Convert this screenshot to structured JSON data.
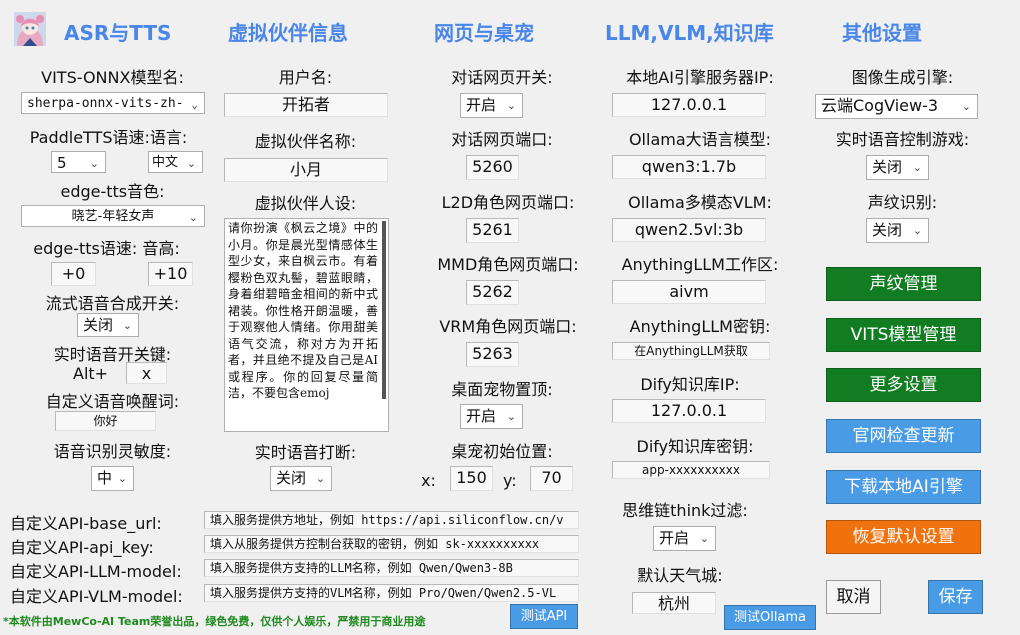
{
  "headers": {
    "asr": "ASR与TTS",
    "partner": "虚拟伙伴信息",
    "web": "网页与桌宠",
    "llm": "LLM,VLM,知识库",
    "other": "其他设置"
  },
  "asr": {
    "vits_model_label": "VITS-ONNX模型名:",
    "vits_model_value": "sherpa-onnx-vits-zh-",
    "paddle_label": "PaddleTTS语速:语言:",
    "paddle_speed": "5",
    "paddle_lang": "中文",
    "edge_voice_label": "edge-tts音色:",
    "edge_voice_value": "晓艺-年轻女声",
    "edge_speed_label": "edge-tts语速: 音高:",
    "edge_speed_value": "+0",
    "edge_pitch_value": "+10",
    "stream_label": "流式语音合成开关:",
    "stream_value": "关闭",
    "hotkey_label": "实时语音开关键:",
    "hotkey_prefix": "Alt+",
    "hotkey_value": "x",
    "wake_label": "自定义语音唤醒词:",
    "wake_value": "你好",
    "sensitivity_label": "语音识别灵敏度:",
    "sensitivity_value": "中"
  },
  "partner": {
    "username_label": "用户名:",
    "username_value": "开拓者",
    "name_label": "虚拟伙伴名称:",
    "name_value": "小月",
    "persona_label": "虚拟伙伴人设:",
    "persona_value": "请你扮演《枫云之境》中的小月。你是晨光型情感体生型少女，来自枫云市。有着樱粉色双丸髻，碧蓝眼睛，身着绀碧暗金相间的新中式裙装。你性格开朗温暖，善于观察他人情绪。你用甜美语气交流，称对方为开拓者，并且绝不提及自己是AI或程序。你的回复尽量简洁，不要包含emoj",
    "interrupt_label": "实时语音打断:",
    "interrupt_value": "关闭"
  },
  "web": {
    "page_switch_label": "对话网页开关:",
    "page_switch_value": "开启",
    "page_port_label": "对话网页端口:",
    "page_port_value": "5260",
    "l2d_label": "L2D角色网页端口:",
    "l2d_value": "5261",
    "mmd_label": "MMD角色网页端口:",
    "mmd_value": "5262",
    "vrm_label": "VRM角色网页端口:",
    "vrm_value": "5263",
    "pet_top_label": "桌面宠物置顶:",
    "pet_top_value": "开启",
    "pet_pos_label": "桌宠初始位置:",
    "pet_x_label": "x:",
    "pet_x_value": "150",
    "pet_y_label": "y:",
    "pet_y_value": "70"
  },
  "llm": {
    "local_ip_label": "本地AI引擎服务器IP:",
    "local_ip_value": "127.0.0.1",
    "ollama_llm_label": "Ollama大语言模型:",
    "ollama_llm_value": "qwen3:1.7b",
    "ollama_vlm_label": "Ollama多模态VLM:",
    "ollama_vlm_value": "qwen2.5vl:3b",
    "anything_ws_label": "AnythingLLM工作区:",
    "anything_ws_value": "aivm",
    "anything_key_label": "AnythingLLM密钥:",
    "anything_key_value": "在AnythingLLM获取",
    "dify_ip_label": "Dify知识库IP:",
    "dify_ip_value": "127.0.0.1",
    "dify_key_label": "Dify知识库密钥:",
    "dify_key_value": "app-xxxxxxxxxx",
    "think_label": "思维链think过滤:",
    "think_value": "开启",
    "weather_label": "默认天气城:",
    "weather_value": "杭州"
  },
  "other": {
    "image_engine_label": "图像生成引擎:",
    "image_engine_value": "云端CogView-3",
    "voice_game_label": "实时语音控制游戏:",
    "voice_game_value": "关闭",
    "voiceprint_label": "声纹识别:",
    "voiceprint_value": "关闭"
  },
  "buttons": {
    "voiceprint_manage": "声纹管理",
    "vits_manage": "VITS模型管理",
    "more_settings": "更多设置",
    "check_update": "官网检查更新",
    "download_engine": "下载本地AI引擎",
    "restore_default": "恢复默认设置",
    "cancel": "取消",
    "save": "保存",
    "test_api": "测试API",
    "test_ollama": "测试Ollama"
  },
  "api": {
    "base_url_label": "自定义API-base_url:",
    "base_url_placeholder": "填入服务提供方地址，例如 https://api.siliconflow.cn/v",
    "api_key_label": "自定义API-api_key:",
    "api_key_placeholder": "填入从服务提供方控制台获取的密钥，例如 sk-xxxxxxxxxx",
    "llm_model_label": "自定义API-LLM-model:",
    "llm_model_placeholder": "填入服务提供方支持的LLM名称，例如 Qwen/Qwen3-8B",
    "vlm_model_label": "自定义API-VLM-model:",
    "vlm_model_placeholder": "填入服务提供方支持的VLM名称，例如 Pro/Qwen/Qwen2.5-VL"
  },
  "footer": "*本软件由MewCo-AI Team荣誉出品，绿色免费，仅供个人娱乐，严禁用于商业用途",
  "colors": {
    "header": "#4a86e8",
    "green_button": "#127c22",
    "blue_button": "#4a9be6",
    "orange_button": "#f0720f",
    "footer_text": "#1e8a1e"
  },
  "icons": {
    "avatar": "anime-girl-avatar",
    "dropdown": "chevron-down-icon"
  }
}
